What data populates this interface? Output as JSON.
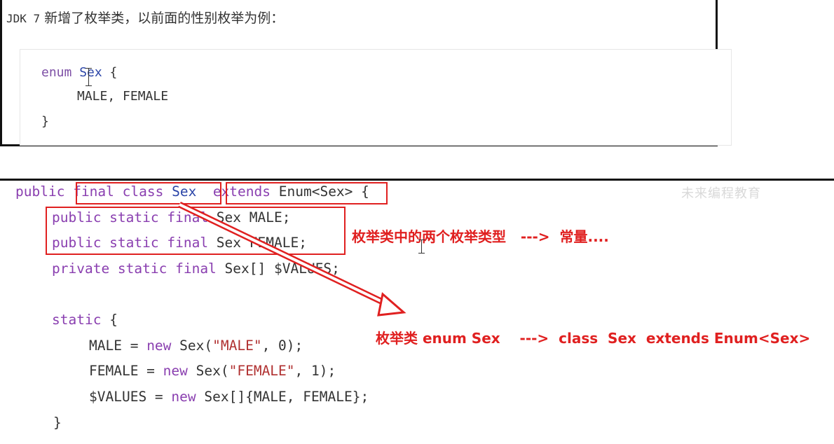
{
  "top": {
    "title_prefix": "JDK 7",
    "title_text": " 新增了枚举类，以前面的性别枚举为例：",
    "code": {
      "line1_kw": "enum",
      "line1_name": "Sex",
      "line1_brace": " {",
      "line2": "MALE, FEMALE",
      "line3": "}"
    }
  },
  "bottom": {
    "code": {
      "l1_public": "public",
      "l1_final_class": "final class",
      "l1_sex": "Sex",
      "l1_extends": "extends",
      "l1_enum": "Enum<Sex>",
      "l1_brace": " {",
      "l2_mods": "public static final",
      "l2_rest": " Sex MALE;",
      "l3_mods": "public static final",
      "l3_rest": " Sex FEMALE;",
      "l4_mods": "private static final",
      "l4_rest": " Sex[] $VALUES;",
      "l5_static": "static",
      "l5_brace": " {",
      "l6_a": "MALE = ",
      "l6_new": "new",
      "l6_b": " Sex(",
      "l6_str": "\"MALE\"",
      "l6_c": ", 0);",
      "l7_a": "FEMALE = ",
      "l7_new": "new",
      "l7_b": " Sex(",
      "l7_str": "\"FEMALE\"",
      "l7_c": ", 1);",
      "l8_a": "$VALUES = ",
      "l8_new": "new",
      "l8_b": " Sex[]{MALE, FEMALE};",
      "l9": "}"
    },
    "annotations": {
      "constants_note": "枚举类中的两个枚举类型   --->  常量....",
      "class_note": "枚举类 enum Sex    --->  class  Sex  extends Enum<Sex>"
    },
    "watermark": "未来编程教育"
  },
  "colors": {
    "annotation_red": "#e02020",
    "keyword_purple": "#8a3fb0",
    "keyword_blue": "#2b45a8"
  }
}
